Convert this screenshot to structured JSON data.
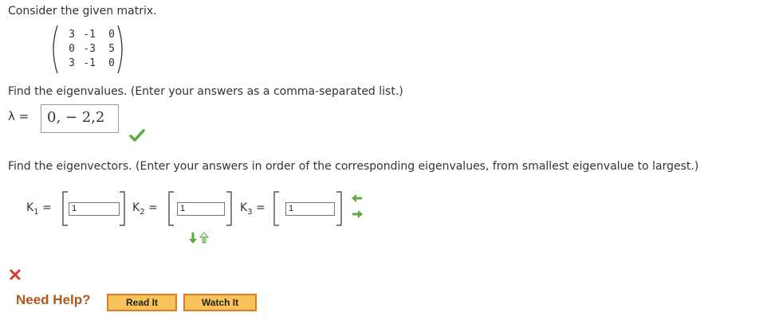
{
  "question": {
    "intro": "Consider the given matrix.",
    "matrix": [
      [
        "3",
        "-1",
        "0"
      ],
      [
        "0",
        "-3",
        "5"
      ],
      [
        "3",
        "-1",
        "0"
      ]
    ]
  },
  "eigenvalues": {
    "prompt": "Find the eigenvalues. (Enter your answers as a comma-separated list.)",
    "symbol": "λ =",
    "answer": "0, − 2,2",
    "status": "correct"
  },
  "eigenvectors": {
    "prompt": "Find the eigenvectors. (Enter your answers in order of the corresponding eigenvalues, from smallest eigenvalue to largest.)",
    "vectors": [
      {
        "label": "K",
        "sub": "1",
        "eq": "=",
        "value": "1"
      },
      {
        "label": "K",
        "sub": "2",
        "eq": "=",
        "value": "1"
      },
      {
        "label": "K",
        "sub": "3",
        "eq": "=",
        "value": "1"
      }
    ],
    "status": "incorrect"
  },
  "help": {
    "label": "Need Help?",
    "read_button": "Read It",
    "watch_button": "Watch It"
  },
  "colors": {
    "correct": "#5aaa3c",
    "incorrect": "#d9372b",
    "arrow_green": "#5aaa3c",
    "button_bg": "#f7c35a",
    "button_border": "#e07b1f",
    "help_text": "#b3561f"
  }
}
